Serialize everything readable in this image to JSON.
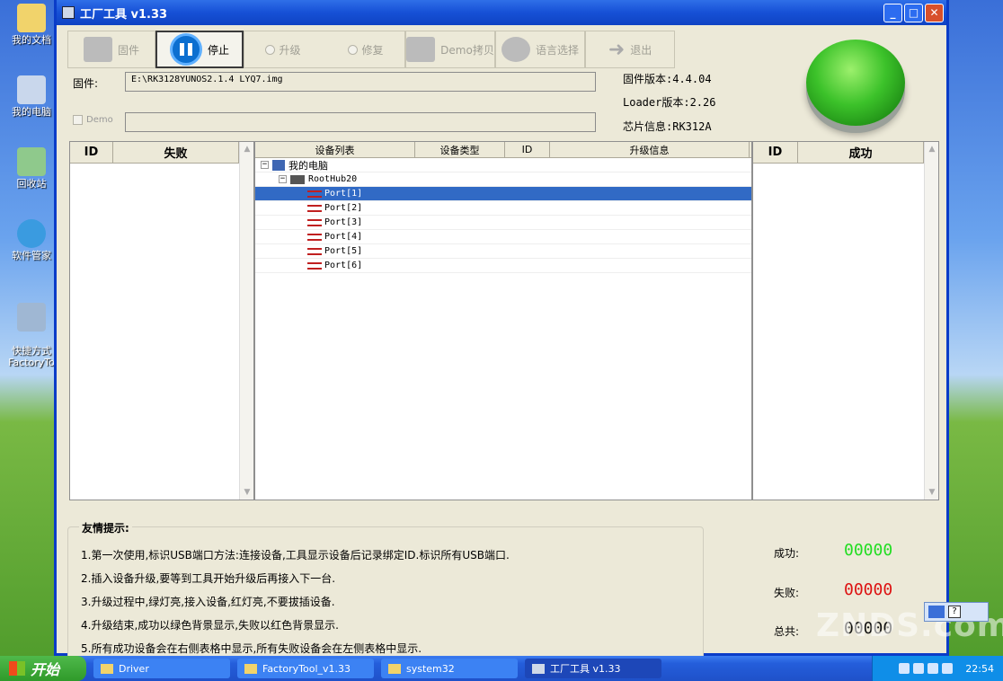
{
  "desktop": {
    "icons": [
      {
        "label": "我的文档"
      },
      {
        "label": "我的电脑"
      },
      {
        "label": "回收站"
      },
      {
        "label": "软件管家"
      },
      {
        "label": "快捷方式\nFactoryTo"
      }
    ]
  },
  "window": {
    "title": "工厂工具 v1.33",
    "buttons": {
      "minimize": "_",
      "maximize": "□",
      "close": "✕"
    }
  },
  "toolbar": {
    "firmware": "固件",
    "stop": "停止",
    "upgrade": "升级",
    "repair": "修复",
    "demo_copy": "Demo拷贝",
    "language": "语言选择",
    "exit": "退出"
  },
  "firmware": {
    "label": "固件:",
    "path": "E:\\RK3128YUNOS2.1.4 LYQ7.img",
    "demo_label": "Demo",
    "demo_value": ""
  },
  "info": {
    "firmware_version": "固件版本:4.4.04",
    "loader_version": "Loader版本:2.26",
    "chip": "芯片信息:RK312A"
  },
  "fail_grid": {
    "id": "ID",
    "title": "失败"
  },
  "success_grid": {
    "id": "ID",
    "title": "成功"
  },
  "device_tree": {
    "columns": [
      "设备列表",
      "设备类型",
      "ID",
      "升级信息"
    ],
    "root": "我的电脑",
    "hub": "RootHub20",
    "ports": [
      "Port[1]",
      "Port[2]",
      "Port[3]",
      "Port[4]",
      "Port[5]",
      "Port[6]"
    ],
    "selected_port": "Port[1]"
  },
  "tips": {
    "title": "友情提示:",
    "items": [
      "1.第一次使用,标识USB端口方法:连接设备,工具显示设备后记录绑定ID.标识所有USB端口.",
      "2.插入设备升级,要等到工具开始升级后再接入下一台.",
      "3.升级过程中,绿灯亮,接入设备,红灯亮,不要拔插设备.",
      "4.升级结束,成功以绿色背景显示,失败以红色背景显示.",
      "5.所有成功设备会在右侧表格中显示,所有失败设备会在左侧表格中显示."
    ]
  },
  "stats": {
    "success_label": "成功:",
    "success": "00000",
    "fail_label": "失败:",
    "fail": "00000",
    "total_label": "总共:",
    "total": "00000",
    "colors": {
      "success": "#22dd22",
      "fail": "#dd1111",
      "total": "#111111"
    }
  },
  "taskbar": {
    "start": "开始",
    "tasks": [
      "Driver",
      "FactoryTool_v1.33",
      "system32",
      "工厂工具 v1.33"
    ],
    "clock": "22:54"
  },
  "watermark": "ZNDS.com"
}
